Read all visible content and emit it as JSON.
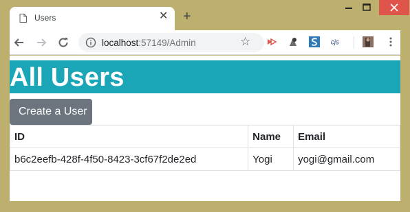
{
  "browser": {
    "tab_title": "Users",
    "tab_close": "✕",
    "new_tab": "+",
    "url_host": "localhost",
    "url_rest": ":57149/Admin",
    "star": "☆"
  },
  "page": {
    "title": "All Users",
    "create_button": "Create a User",
    "table": {
      "columns": [
        "ID",
        "Name",
        "Email"
      ],
      "rows": [
        [
          "b6c2eefb-428f-4f50-8423-3cf67f2de2ed",
          "Yogi",
          "yogi@gmail.com"
        ]
      ]
    }
  },
  "colors": {
    "banner": "#1aa6b7",
    "button": "#6c757d",
    "frame": "#bdb06f",
    "close": "#e0554b"
  }
}
